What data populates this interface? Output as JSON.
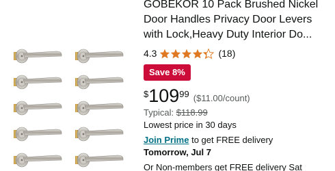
{
  "product": {
    "title_lines": [
      "GOBEKOR 10 Pack Brushed Nickel",
      "Door Handles Privacy Door Levers",
      "with Lock,Heavy Duty Interior Do..."
    ],
    "rating": "4.3",
    "rating_value": 4.3,
    "review_count": "(18)",
    "save_badge": "Save 8%",
    "price_symbol": "$",
    "price_whole": "109",
    "price_fraction": "99",
    "unit_price": "($11.00/count)",
    "typical_label": "Typical: ",
    "typical_price": "$118.99",
    "lowest_price_text": "Lowest price in 30 days",
    "prime_link": "Join Prime",
    "prime_suffix": " to get FREE delivery",
    "delivery_date": "Tomorrow, Jul 7",
    "nonmember_text": "Or Non-members get FREE delivery Sat"
  },
  "colors": {
    "badge_red": "#cc0c39",
    "star_orange": "#de7921",
    "link_teal": "#007185",
    "nickel": "#b9b6af",
    "brass": "#c9a24a"
  },
  "icons": [
    "door-lever-icon",
    "star-icon"
  ]
}
